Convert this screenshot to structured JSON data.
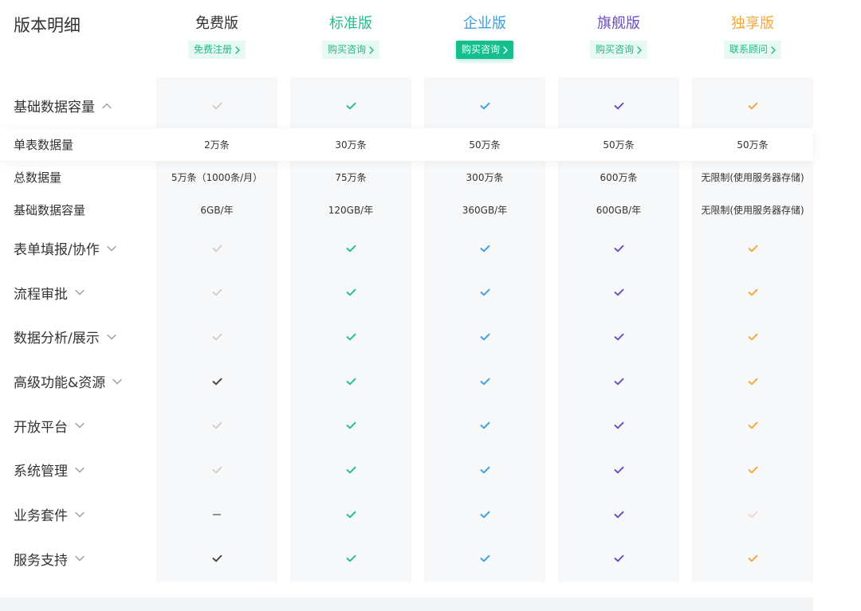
{
  "title": "版本明细",
  "colors": {
    "text": "#333333",
    "column_background": "#f6f8fa",
    "button_light_background": "#e8f8f2",
    "button_light_text": "#1fb98a",
    "button_solid_background": "#13bf8c",
    "button_solid_text": "#ffffff",
    "check_muted": "#cfcfcf",
    "check_dark": "#444444",
    "check_faded": "#f4d4d1",
    "dash": "#555555",
    "chevron": "#999999"
  },
  "plans": [
    {
      "name": "免费版",
      "color": "#333333",
      "button": {
        "label": "免费注册",
        "icon": "chevron-right-icon",
        "style": "light"
      }
    },
    {
      "name": "标准版",
      "color": "#22bf8c",
      "button": {
        "label": "购买咨询",
        "icon": "chevron-right-icon",
        "style": "light"
      }
    },
    {
      "name": "企业版",
      "color": "#3c9fe2",
      "button": {
        "label": "购买咨询",
        "icon": "chevron-right-icon",
        "style": "solid"
      }
    },
    {
      "name": "旗舰版",
      "color": "#6c4cc5",
      "button": {
        "label": "购买咨询",
        "icon": "chevron-right-icon",
        "style": "light"
      }
    },
    {
      "name": "独享版",
      "color": "#f4a73c",
      "button": {
        "label": "联系顾问",
        "icon": "chevron-right-icon",
        "style": "light"
      }
    }
  ],
  "rows": [
    {
      "label": "基础数据容量",
      "kind": "section",
      "toggle_icon": "chevron-up-icon",
      "cells": [
        {
          "icon": "check-icon",
          "tone": "muted"
        },
        {
          "icon": "check-icon",
          "tone": "plan"
        },
        {
          "icon": "check-icon",
          "tone": "plan"
        },
        {
          "icon": "check-icon",
          "tone": "plan"
        },
        {
          "icon": "check-icon",
          "tone": "plan"
        }
      ]
    },
    {
      "label": "单表数据量",
      "kind": "sub",
      "highlighted": true,
      "cells": [
        {
          "text": "2万条"
        },
        {
          "text": "30万条"
        },
        {
          "text": "50万条"
        },
        {
          "text": "50万条"
        },
        {
          "text": "50万条"
        }
      ]
    },
    {
      "label": "总数据量",
      "kind": "sub",
      "cells": [
        {
          "text": "5万条（1000条/月）"
        },
        {
          "text": "75万条"
        },
        {
          "text": "300万条"
        },
        {
          "text": "600万条"
        },
        {
          "text": "无限制(使用服务器存储)"
        }
      ]
    },
    {
      "label": "基础数据容量",
      "kind": "sub",
      "cells": [
        {
          "text": "6GB/年"
        },
        {
          "text": "120GB/年"
        },
        {
          "text": "360GB/年"
        },
        {
          "text": "600GB/年"
        },
        {
          "text": "无限制(使用服务器存储)"
        }
      ]
    },
    {
      "label": "表单填报/协作",
      "kind": "section",
      "toggle_icon": "chevron-down-icon",
      "cells": [
        {
          "icon": "check-icon",
          "tone": "muted"
        },
        {
          "icon": "check-icon",
          "tone": "plan"
        },
        {
          "icon": "check-icon",
          "tone": "plan"
        },
        {
          "icon": "check-icon",
          "tone": "plan"
        },
        {
          "icon": "check-icon",
          "tone": "plan"
        }
      ]
    },
    {
      "label": "流程审批",
      "kind": "section",
      "toggle_icon": "chevron-down-icon",
      "cells": [
        {
          "icon": "check-icon",
          "tone": "muted"
        },
        {
          "icon": "check-icon",
          "tone": "plan"
        },
        {
          "icon": "check-icon",
          "tone": "plan"
        },
        {
          "icon": "check-icon",
          "tone": "plan"
        },
        {
          "icon": "check-icon",
          "tone": "plan"
        }
      ]
    },
    {
      "label": "数据分析/展示",
      "kind": "section",
      "toggle_icon": "chevron-down-icon",
      "cells": [
        {
          "icon": "check-icon",
          "tone": "muted"
        },
        {
          "icon": "check-icon",
          "tone": "plan"
        },
        {
          "icon": "check-icon",
          "tone": "plan"
        },
        {
          "icon": "check-icon",
          "tone": "plan"
        },
        {
          "icon": "check-icon",
          "tone": "plan"
        }
      ]
    },
    {
      "label": "高级功能&资源",
      "kind": "section",
      "toggle_icon": "chevron-down-icon",
      "cells": [
        {
          "icon": "check-icon",
          "tone": "dark"
        },
        {
          "icon": "check-icon",
          "tone": "plan"
        },
        {
          "icon": "check-icon",
          "tone": "plan"
        },
        {
          "icon": "check-icon",
          "tone": "plan"
        },
        {
          "icon": "check-icon",
          "tone": "plan"
        }
      ]
    },
    {
      "label": "开放平台",
      "kind": "section",
      "toggle_icon": "chevron-down-icon",
      "cells": [
        {
          "icon": "check-icon",
          "tone": "muted"
        },
        {
          "icon": "check-icon",
          "tone": "plan"
        },
        {
          "icon": "check-icon",
          "tone": "plan"
        },
        {
          "icon": "check-icon",
          "tone": "plan"
        },
        {
          "icon": "check-icon",
          "tone": "plan"
        }
      ]
    },
    {
      "label": "系统管理",
      "kind": "section",
      "toggle_icon": "chevron-down-icon",
      "cells": [
        {
          "icon": "check-icon",
          "tone": "muted"
        },
        {
          "icon": "check-icon",
          "tone": "plan"
        },
        {
          "icon": "check-icon",
          "tone": "plan"
        },
        {
          "icon": "check-icon",
          "tone": "plan"
        },
        {
          "icon": "check-icon",
          "tone": "plan"
        }
      ]
    },
    {
      "label": "业务套件",
      "kind": "section",
      "toggle_icon": "chevron-down-icon",
      "cells": [
        {
          "icon": "dash-icon"
        },
        {
          "icon": "check-icon",
          "tone": "plan"
        },
        {
          "icon": "check-icon",
          "tone": "plan"
        },
        {
          "icon": "check-icon",
          "tone": "plan"
        },
        {
          "icon": "check-icon",
          "tone": "faded"
        }
      ]
    },
    {
      "label": "服务支持",
      "kind": "section",
      "toggle_icon": "chevron-down-icon",
      "cells": [
        {
          "icon": "check-icon",
          "tone": "dark"
        },
        {
          "icon": "check-icon",
          "tone": "plan"
        },
        {
          "icon": "check-icon",
          "tone": "plan"
        },
        {
          "icon": "check-icon",
          "tone": "plan"
        },
        {
          "icon": "check-icon",
          "tone": "plan"
        }
      ]
    }
  ]
}
